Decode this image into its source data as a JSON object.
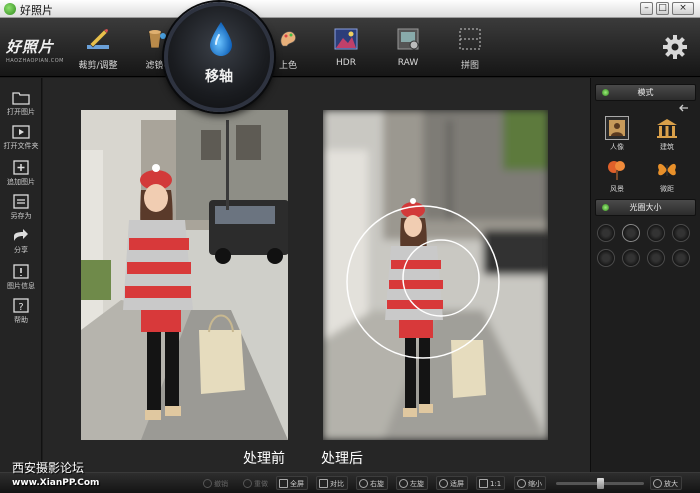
{
  "window": {
    "title": "好照片"
  },
  "logo": {
    "brand": "好照片",
    "sub": "HAOZHAOPIAN.COM"
  },
  "toolbar": {
    "items": [
      {
        "label": "裁剪/调整",
        "icon": "pencil-ruler-icon"
      },
      {
        "label": "滤镜/",
        "icon": "filter-bucket-icon"
      },
      {
        "label": "上色",
        "icon": "colorize-icon"
      },
      {
        "label": "HDR",
        "icon": "hdr-icon"
      },
      {
        "label": "RAW",
        "icon": "raw-icon"
      },
      {
        "label": "拼图",
        "icon": "collage-icon"
      }
    ],
    "active": {
      "label": "移轴",
      "icon": "water-drop-icon"
    }
  },
  "sidebar": {
    "items": [
      {
        "label": "打开图片",
        "icon": "folder-icon"
      },
      {
        "label": "打开文件夹",
        "icon": "play-folder-icon"
      },
      {
        "label": "追加图片",
        "icon": "add-image-icon"
      },
      {
        "label": "另存为",
        "icon": "save-as-icon"
      },
      {
        "label": "分享",
        "icon": "share-icon"
      },
      {
        "label": "图片信息",
        "icon": "info-icon"
      },
      {
        "label": "帮助",
        "icon": "help-icon"
      }
    ]
  },
  "canvas": {
    "before_label": "处理前",
    "after_label": "处理后"
  },
  "panel": {
    "mode_title": "模式",
    "modes": [
      {
        "label": "人像",
        "icon": "portrait-icon",
        "selected": true
      },
      {
        "label": "建筑",
        "icon": "building-icon",
        "selected": false
      },
      {
        "label": "风景",
        "icon": "landscape-tree-icon",
        "selected": false
      },
      {
        "label": "微距",
        "icon": "macro-butterfly-icon",
        "selected": false
      }
    ],
    "aperture_title": "光圈大小"
  },
  "bottombar": {
    "buttons": [
      {
        "label": "撤销",
        "enabled": false
      },
      {
        "label": "重做",
        "enabled": false
      },
      {
        "label": "全屏",
        "enabled": true
      },
      {
        "label": "对比",
        "enabled": true
      },
      {
        "label": "右旋",
        "enabled": true
      },
      {
        "label": "左旋",
        "enabled": true
      },
      {
        "label": "适屏",
        "enabled": true
      },
      {
        "label": "1:1",
        "enabled": true
      },
      {
        "label": "缩小",
        "enabled": true
      },
      {
        "label": "放大",
        "enabled": true
      }
    ],
    "zoom_level": 0.5
  },
  "watermark": {
    "text": "西安摄影论坛",
    "url": "www.XianPP.Com"
  },
  "colors": {
    "accent_green": "#6fd34e",
    "bubble_blue": "#1e88e5"
  }
}
